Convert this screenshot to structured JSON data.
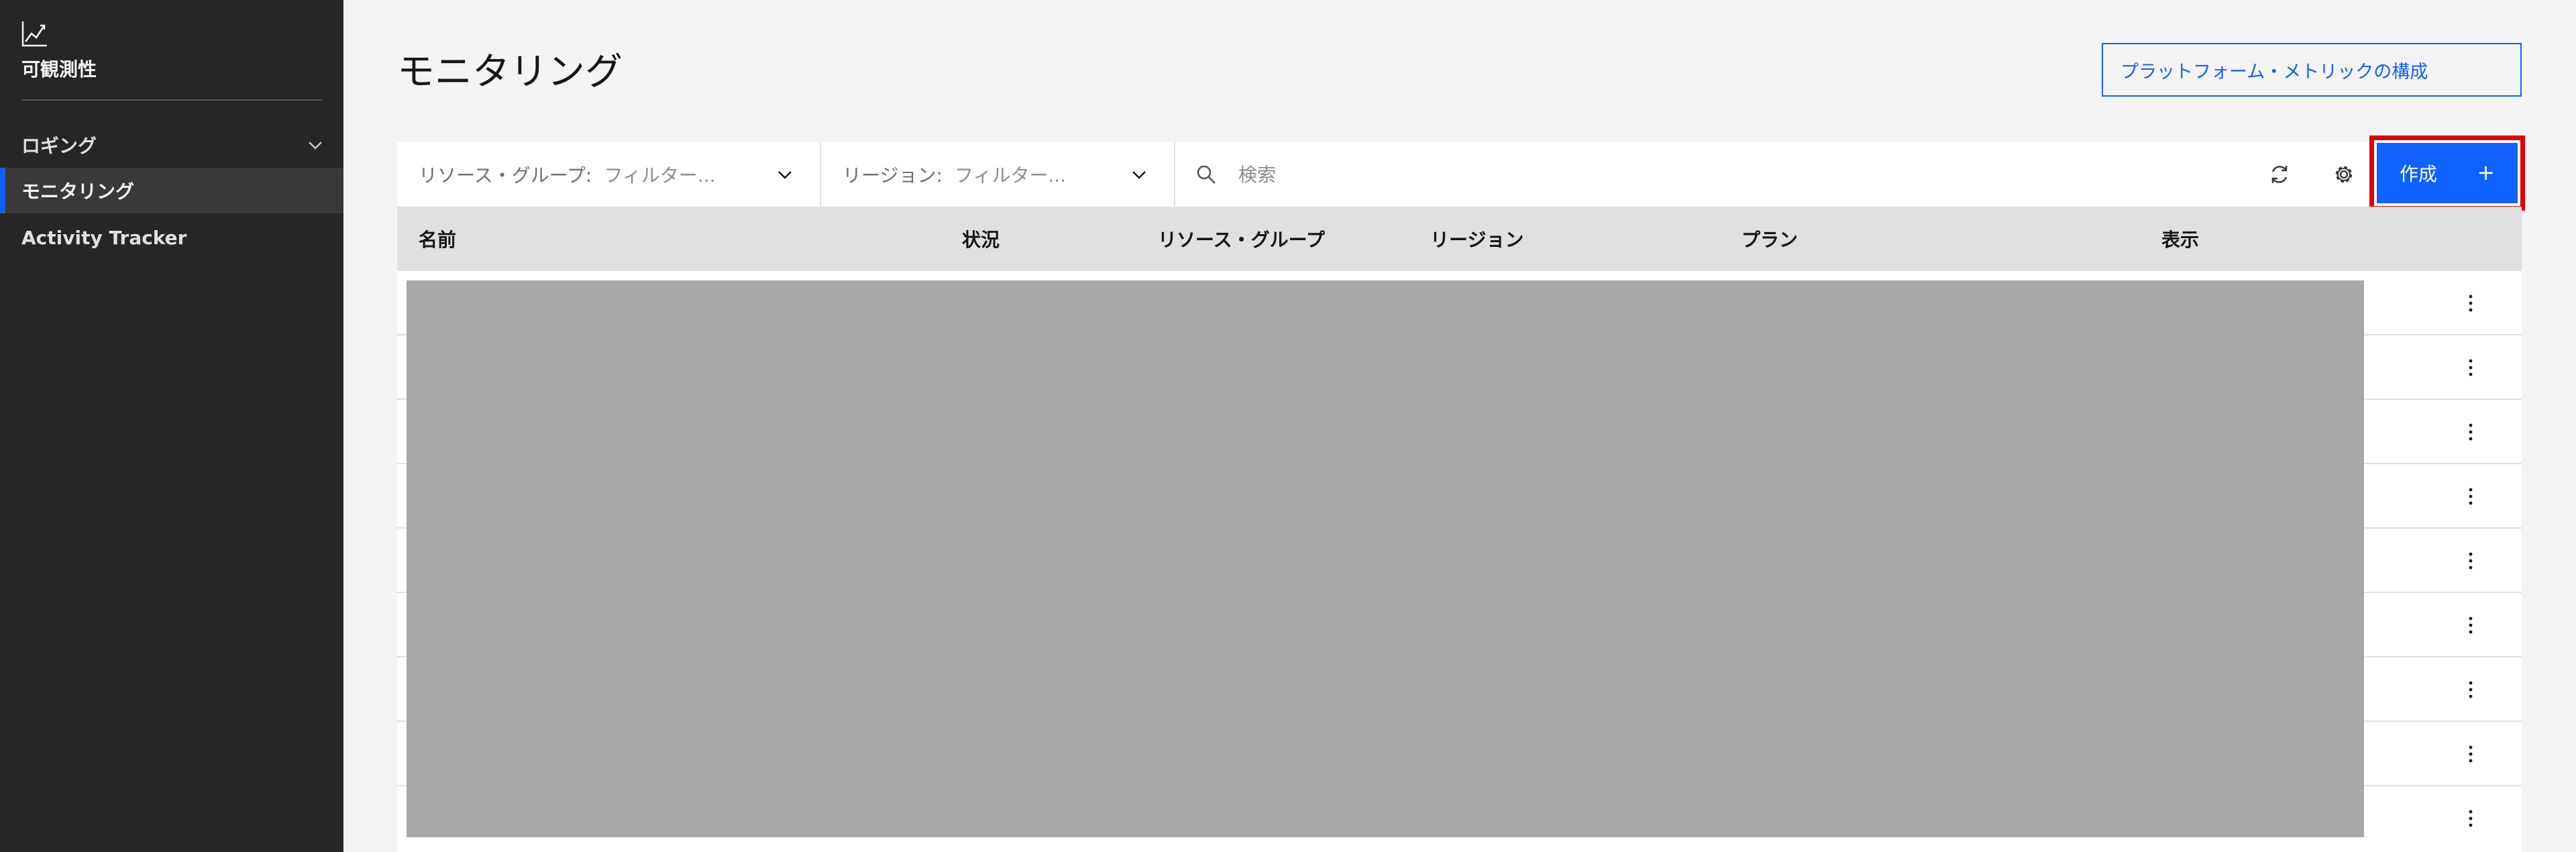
{
  "sidebar": {
    "app_title": "可観測性",
    "logo_icon": "line-chart-icon",
    "items": [
      {
        "label": "ロギング",
        "has_chevron": true
      },
      {
        "label": "モニタリング",
        "active": true
      },
      {
        "label": "Activity Tracker"
      }
    ]
  },
  "header": {
    "title": "モニタリング",
    "config_button": "プラットフォーム・メトリックの構成"
  },
  "toolbar": {
    "resource_group_label": "リソース・グループ:",
    "resource_group_value": "フィルター...",
    "region_label": "リージョン:",
    "region_value": "フィルター...",
    "search_placeholder": "検索",
    "create_label": "作成",
    "create_icon": "+",
    "refresh_icon": "refresh-icon",
    "settings_icon": "gear-icon"
  },
  "table": {
    "columns": [
      "名前",
      "状況",
      "リソース・グループ",
      "リージョン",
      "プラン",
      "表示"
    ],
    "row_count": 9,
    "row_content_redacted": true
  },
  "colors": {
    "sidebar_bg": "#262626",
    "accent": "#0f62fe",
    "highlight_box": "#e00000",
    "redaction": "#a8a8a8"
  }
}
